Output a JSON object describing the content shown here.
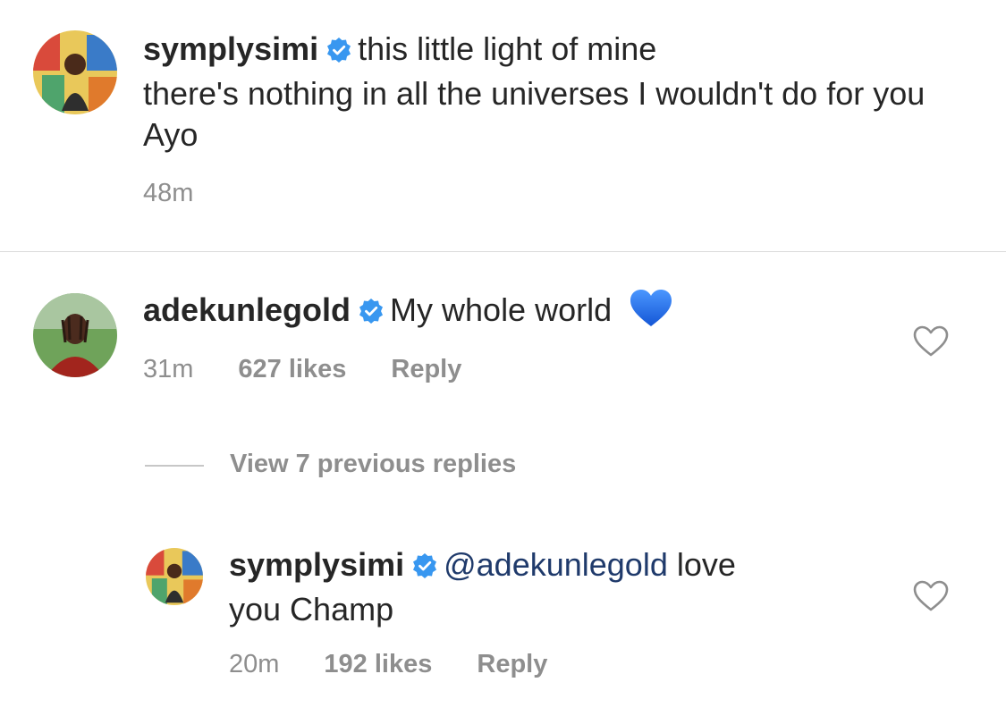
{
  "caption": {
    "username": "symplysimi",
    "first_line": "this little light of mine",
    "body": "there's nothing in all the universes I wouldn't do for you Ayo",
    "time": "48m"
  },
  "comment": {
    "username": "adekunlegold",
    "text": "My whole world",
    "emoji": "blue-heart-emoji",
    "time": "31m",
    "likes": "627 likes",
    "reply_label": "Reply"
  },
  "view_replies": "View 7 previous replies",
  "reply": {
    "username": "symplysimi",
    "mention": "@adekunlegold",
    "text_tail": "love",
    "text_line2": "you Champ",
    "time": "20m",
    "likes": "192 likes",
    "reply_label": "Reply"
  },
  "colors": {
    "verified_badge": "#3897f0",
    "mention": "#1f3a6b",
    "meta_gray": "#8e8e8e",
    "blue_heart": "#1f6fe5"
  }
}
